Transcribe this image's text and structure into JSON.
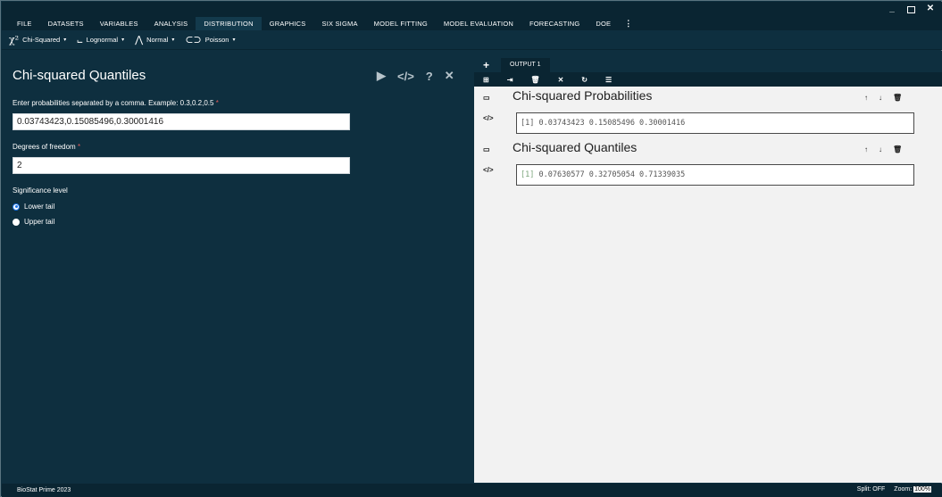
{
  "menubar": {
    "items": [
      "FILE",
      "DATASETS",
      "VARIABLES",
      "ANALYSIS",
      "DISTRIBUTION",
      "GRAPHICS",
      "SIX SIGMA",
      "MODEL FITTING",
      "MODEL EVALUATION",
      "FORECASTING",
      "DOE"
    ],
    "active": "DISTRIBUTION",
    "more": "⋮"
  },
  "window": {
    "minimize": "_",
    "close": "✕"
  },
  "subbar": {
    "chisq": {
      "icon": "χ²",
      "label": "Chi-Squared"
    },
    "lognormal": {
      "icon": "⨽",
      "label": "Lognormal"
    },
    "normal": {
      "icon": "⋀",
      "label": "Normal"
    },
    "poisson": {
      "icon": "⊂⊃",
      "label": "Poisson"
    },
    "caret": "▾"
  },
  "left": {
    "title": "Chi-squared Quantiles",
    "actions": {
      "run": "▶",
      "code": "</>",
      "help": "?",
      "close": "✕"
    },
    "prob_label": "Enter probabilities separated by a comma. Example: 0.3,0.2,0.5",
    "prob_value": "0.03743423,0.15085496,0.30001416",
    "df_label": "Degrees of freedom",
    "df_value": "2",
    "required": "*",
    "sig_label": "Significance level",
    "lower_tail": "Lower tail",
    "upper_tail": "Upper tail"
  },
  "right": {
    "add_tab": "+",
    "tab": "OUTPUT 1",
    "toolbar": {
      "add": "⊞",
      "export": "⇥",
      "delete": "🗑",
      "close": "✕",
      "refresh": "↻",
      "list": "☰"
    },
    "blocks": [
      {
        "title": "Chi-squared Probabilities",
        "index": "[1]",
        "result": " 0.03743423 0.15085496 0.30001416"
      },
      {
        "title": "Chi-squared Quantiles",
        "index": "[1]",
        "result": " 0.07630577 0.32705054 0.71339035"
      }
    ],
    "side_collapse": "▭",
    "side_code": "</>",
    "up": "↑",
    "down": "↓",
    "trash": "🗑"
  },
  "status": {
    "app_name": "BioStat Prime 2023",
    "split": "Split: OFF",
    "zoom_label": "Zoom:",
    "zoom_value": "100%"
  }
}
